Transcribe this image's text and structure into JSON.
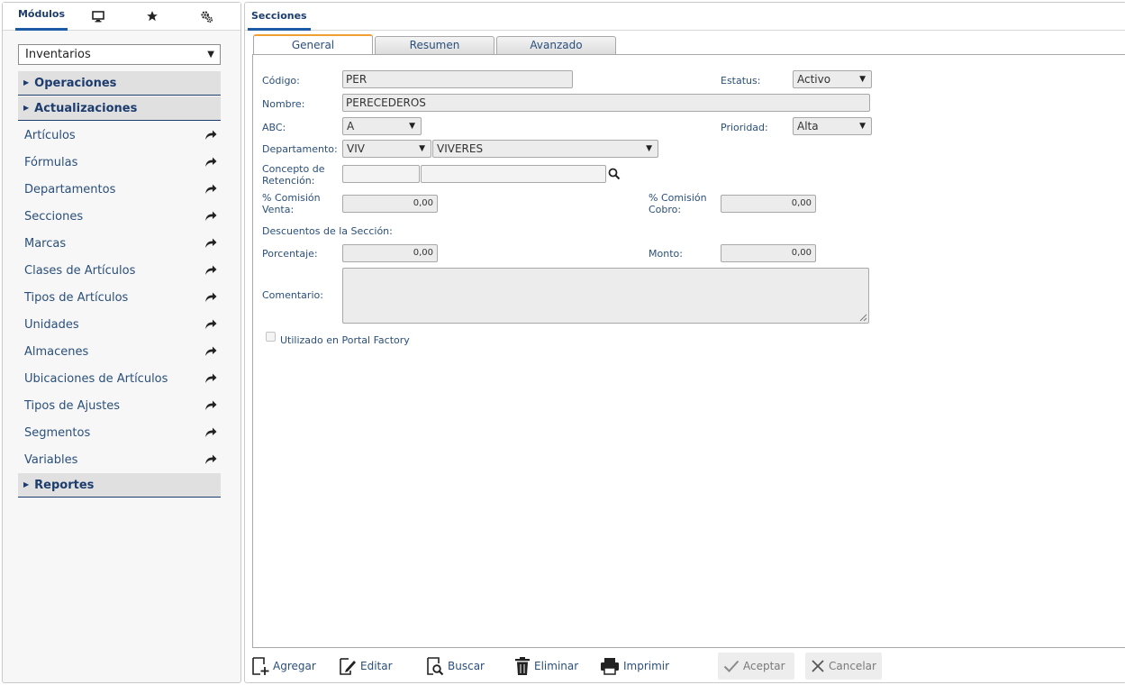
{
  "left_panel": {
    "tab_modules_label": "Módulos",
    "module_selected": "Inventarios",
    "groups": {
      "operaciones": "Operaciones",
      "actualizaciones": "Actualizaciones",
      "reportes": "Reportes"
    },
    "items": [
      {
        "label": "Artículos"
      },
      {
        "label": "Fórmulas"
      },
      {
        "label": "Departamentos"
      },
      {
        "label": "Secciones"
      },
      {
        "label": "Marcas"
      },
      {
        "label": "Clases de Artículos"
      },
      {
        "label": "Tipos de Artículos"
      },
      {
        "label": "Unidades"
      },
      {
        "label": "Almacenes"
      },
      {
        "label": "Ubicaciones de Artículos"
      },
      {
        "label": "Tipos de Ajustes"
      },
      {
        "label": "Segmentos"
      },
      {
        "label": "Variables"
      }
    ],
    "icons": [
      "monitor-icon",
      "star-icon",
      "gears-icon",
      "share-arrow-icon"
    ]
  },
  "right_panel": {
    "title": "Secciones",
    "tabs": [
      {
        "label": "General"
      },
      {
        "label": "Resumen"
      },
      {
        "label": "Avanzado"
      }
    ],
    "form": {
      "codigo_label": "Código:",
      "codigo_value": "PER",
      "estatus_label": "Estatus:",
      "estatus_value": "Activo",
      "nombre_label": "Nombre:",
      "nombre_value": "PERECEDEROS",
      "abc_label": "ABC:",
      "abc_value": "A",
      "prioridad_label": "Prioridad:",
      "prioridad_value": "Alta",
      "departamento_label": "Departamento:",
      "departamento_code": "VIV",
      "departamento_name": "VIVERES",
      "concepto_label_1": "Concepto de",
      "concepto_label_2": "Retención:",
      "concepto_code": "",
      "concepto_name": "",
      "comision_venta_label_1": "% Comisión",
      "comision_venta_label_2": "Venta:",
      "comision_venta_value": "0,00",
      "comision_cobro_label_1": "% Comisión",
      "comision_cobro_label_2": "Cobro:",
      "comision_cobro_value": "0,00",
      "descuentos_label": "Descuentos de la Sección:",
      "porcentaje_label": "Porcentaje:",
      "porcentaje_value": "0,00",
      "monto_label": "Monto:",
      "monto_value": "0,00",
      "comentario_label": "Comentario:",
      "comentario_value": "",
      "portal_factory_label": "Utilizado en Portal Factory"
    },
    "toolbar": {
      "agregar": "Agregar",
      "editar": "Editar",
      "buscar": "Buscar",
      "eliminar": "Eliminar",
      "imprimir": "Imprimir",
      "aceptar": "Aceptar",
      "cancelar": "Cancelar"
    }
  },
  "colors": {
    "accent": "#1d5aa6",
    "heading": "#1d3c6e",
    "active_tab_top": "#f0a030",
    "field_bg": "#ececec"
  }
}
